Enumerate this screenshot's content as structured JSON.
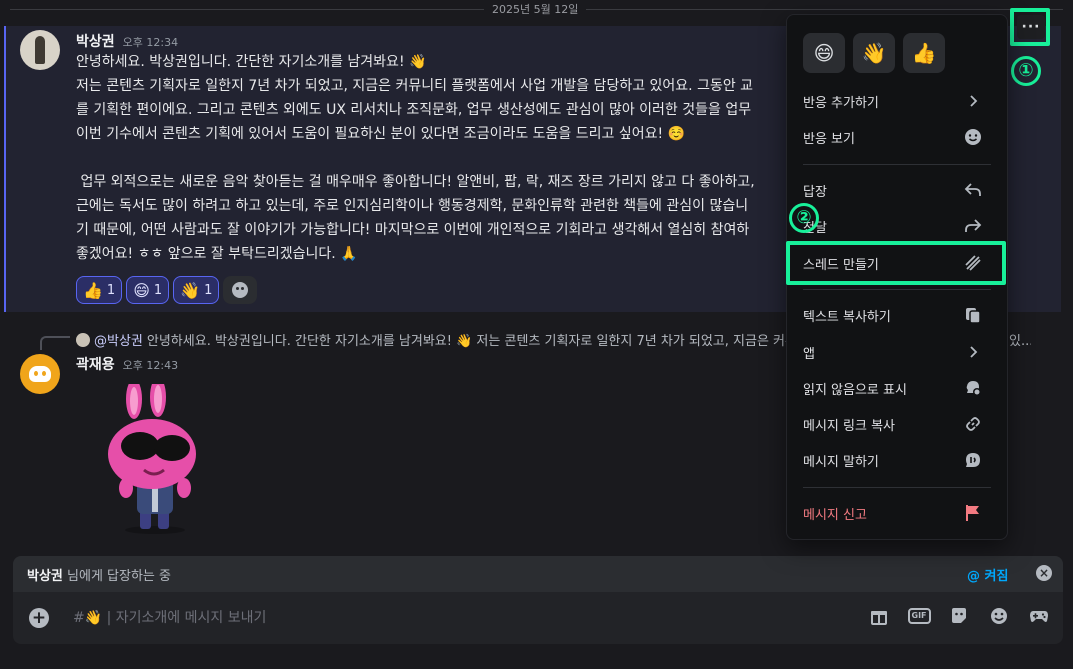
{
  "date_divider": "2025년 5월 12일",
  "message1": {
    "author": "박상권",
    "time": "오후 12:34",
    "paragraphs": [
      "안녕하세요. 박상권입니다. 간단한 자기소개를 남겨봐요! 👋",
      "",
      "저는 콘텐츠 기획자로 일한지 7년 차가 되었고, 지금은 커뮤니티 플랫폼에서 사업 개발을 담당하고 있어요. 그동안 교\n를 기획한 편이에요. 그리고 콘텐츠 외에도 UX 리서치나 조직문화, 업무 생산성에도 관심이 많아 이러한 것들을 업무\n이번 기수에서 콘텐츠 기획에 있어서 도움이 필요하신 분이 있다면 조금이라도 도움을 드리고 싶어요! ☺️",
      "",
      " 업무 외적으로는 새로운 음악 찾아듣는 걸 매우매우 좋아합니다! 알앤비, 팝, 락, 재즈 장르 가리지 않고 다 좋아하고,\n근에는 독서도 많이 하려고 하고 있는데, 주로 인지심리학이나 행동경제학, 문화인류학 관련한 책들에 관심이 많습니\n기 때문에, 어떤 사람과도 잘 이야기가 가능합니다! 마지막으로 이번에 개인적으로 기회라고 생각해서 열심히 참여하\n좋겠어요! ㅎㅎ 앞으로 잘 부탁드리겠습니다. 🙏"
    ],
    "reactions": [
      {
        "emoji": "👍",
        "count": "1"
      },
      {
        "emoji": "😄",
        "count": "1"
      },
      {
        "emoji": "👋",
        "count": "1"
      }
    ]
  },
  "message2": {
    "reply_author": "@박상권",
    "reply_preview": "안녕하세요. 박상권입니다. 간단한 자기소개를 남겨봐요! 👋  저는 콘텐츠 기획자로 일한지 7년 차가 되었고, 지금은 커뮤니티 플랫폼에서 사업 개발을 담당하고 있...",
    "author": "곽재용",
    "time": "오후 12:43"
  },
  "reply_bar": {
    "name": "박상권",
    "suffix": " 님에게 답장하는 중",
    "mention": "@ 켜짐"
  },
  "composer": {
    "placeholder": "#👋 | 자기소개에 메시지 보내기"
  },
  "context_menu": {
    "quick_reactions": [
      "😄",
      "👋",
      "👍"
    ],
    "items": {
      "add_reaction": "반응 추가하기",
      "view_reactions": "반응 보기",
      "reply": "답장",
      "forward": "전달",
      "create_thread": "스레드 만들기",
      "copy_text": "텍스트 복사하기",
      "apps": "앱",
      "mark_unread": "읽지 않음으로 표시",
      "copy_link": "메시지 링크 복사",
      "speak": "메시지 말하기",
      "report": "메시지 신고"
    }
  },
  "annotations": {
    "step1": "①",
    "step2": "②"
  },
  "colors": {
    "highlight": "#18f09a",
    "accent": "#5865f2",
    "danger": "#f37b82"
  }
}
